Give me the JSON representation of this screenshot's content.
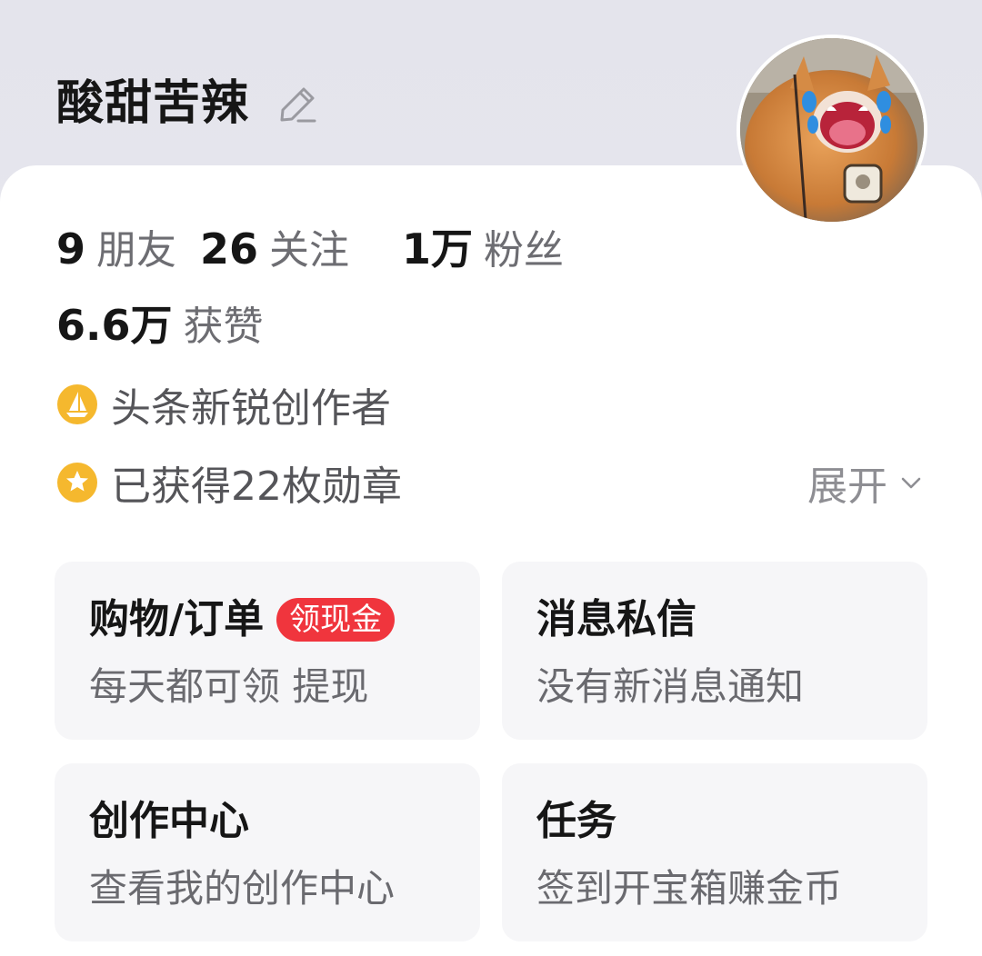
{
  "profile": {
    "username": "酸甜苦辣",
    "edit_icon": "pencil-icon",
    "avatar_desc_icon": "cat-avatar"
  },
  "stats": {
    "friends": {
      "value": "9",
      "label": "朋友"
    },
    "following": {
      "value": "26",
      "label": "关注"
    },
    "fans": {
      "value": "1万",
      "label": "粉丝"
    },
    "likes": {
      "value": "6.6万",
      "label": "获赞"
    }
  },
  "badges": {
    "creator_title": "头条新锐创作者",
    "medals_text": "已获得22枚勋章",
    "expand_label": "展开"
  },
  "tiles": [
    {
      "title": "购物/订单",
      "tag": "领现金",
      "subtitle": "每天都可领 提现"
    },
    {
      "title": "消息私信",
      "subtitle": "没有新消息通知"
    },
    {
      "title": "创作中心",
      "subtitle": "查看我的创作中心"
    },
    {
      "title": "任务",
      "subtitle": "签到开宝箱赚金币"
    }
  ],
  "colors": {
    "accent_red": "#f0353d",
    "badge_gold": "#f5b82e",
    "text_primary": "#161616",
    "text_secondary": "#6d6d72"
  }
}
